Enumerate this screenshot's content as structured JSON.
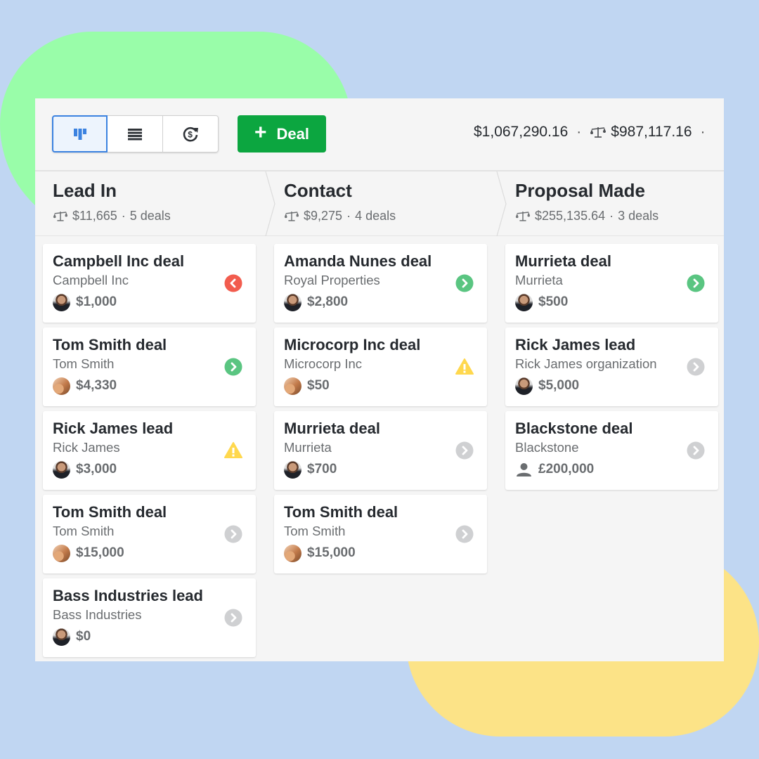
{
  "toolbar": {
    "views": [
      {
        "name": "pipeline-view",
        "active": true
      },
      {
        "name": "list-view",
        "active": false
      },
      {
        "name": "forecast-view",
        "active": false
      }
    ],
    "add_deal": {
      "icon": "plus",
      "label": "Deal"
    },
    "totals": {
      "total_value": "$1,067,290.16",
      "weighted_value": "$987,117.16",
      "separator": "·"
    }
  },
  "colors": {
    "accent_blue": "#3b82e0",
    "add_green": "#0ca640",
    "status_green": "#5ac581",
    "status_red": "#f25c4e",
    "status_yellow": "#ffd84e",
    "status_grey": "#cfd0d2"
  },
  "stages": [
    {
      "title": "Lead In",
      "value": "$11,665",
      "count": "5 deals",
      "deals": [
        {
          "title": "Campbell Inc deal",
          "org": "Campbell Inc",
          "value": "$1,000",
          "avatar": "a1",
          "status": "red-back"
        },
        {
          "title": "Tom Smith deal",
          "org": "Tom Smith",
          "value": "$4,330",
          "avatar": "a2",
          "status": "green"
        },
        {
          "title": "Rick James lead",
          "org": "Rick James",
          "value": "$3,000",
          "avatar": "a1",
          "status": "warning"
        },
        {
          "title": "Tom Smith deal",
          "org": "Tom Smith",
          "value": "$15,000",
          "avatar": "a2",
          "status": "grey"
        },
        {
          "title": "Bass Industries lead",
          "org": "Bass Industries",
          "value": "$0",
          "avatar": "a1",
          "status": "grey"
        }
      ]
    },
    {
      "title": "Contact",
      "value": "$9,275",
      "count": "4 deals",
      "deals": [
        {
          "title": "Amanda Nunes deal",
          "org": "Royal Properties",
          "value": "$2,800",
          "avatar": "a1",
          "status": "green"
        },
        {
          "title": "Microcorp Inc deal",
          "org": "Microcorp Inc",
          "value": "$50",
          "avatar": "a2",
          "status": "warning"
        },
        {
          "title": "Murrieta deal",
          "org": "Murrieta",
          "value": "$700",
          "avatar": "a1",
          "status": "grey"
        },
        {
          "title": "Tom Smith deal",
          "org": "Tom Smith",
          "value": "$15,000",
          "avatar": "a2",
          "status": "grey"
        }
      ]
    },
    {
      "title": "Proposal Made",
      "value": "$255,135.64",
      "count": "3 deals",
      "deals": [
        {
          "title": "Murrieta deal",
          "org": "Murrieta",
          "value": "$500",
          "avatar": "a1",
          "status": "green"
        },
        {
          "title": "Rick James lead",
          "org": "Rick James organization",
          "value": "$5,000",
          "avatar": "a1",
          "status": "grey"
        },
        {
          "title": "Blackstone deal",
          "org": "Blackstone",
          "value": "£200,000",
          "avatar": "person",
          "status": "grey"
        }
      ]
    }
  ]
}
